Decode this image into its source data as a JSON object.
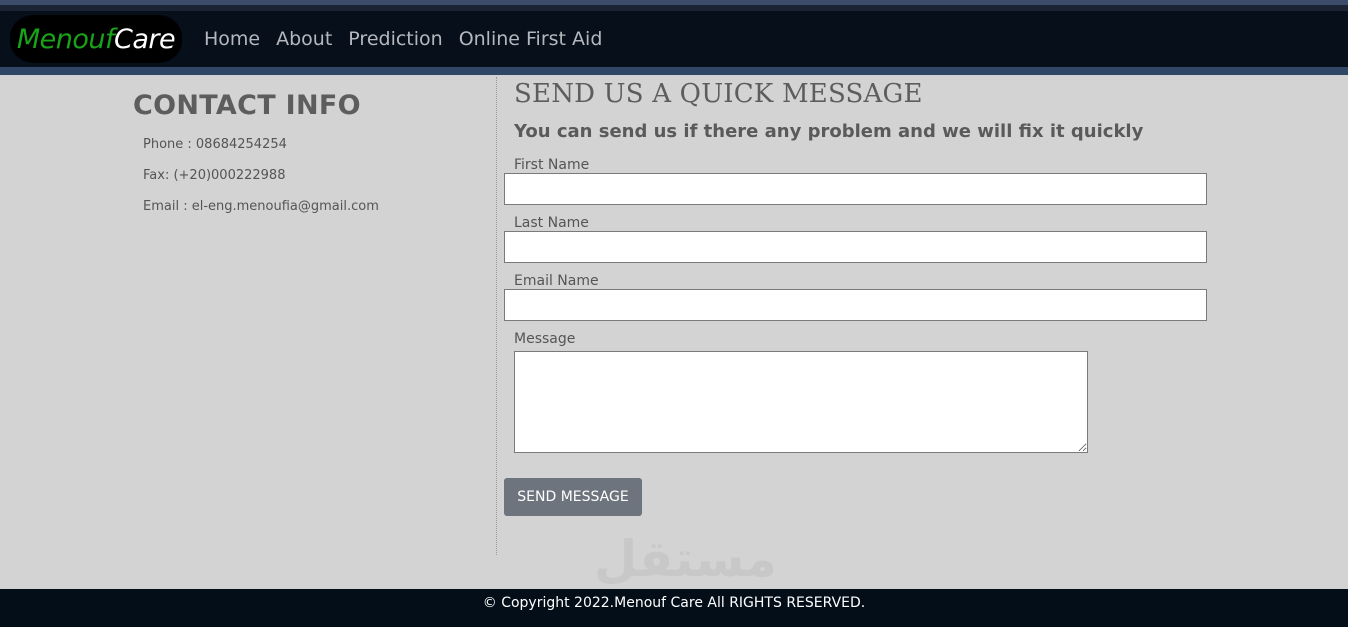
{
  "nav": {
    "logo_part1": "Menouf",
    "logo_part2": "Care",
    "links": [
      "Home",
      "About",
      "Prediction",
      "Online First Aid"
    ],
    "logo_colors": {
      "part1": "#19a319",
      "part2": "#ffffff"
    }
  },
  "contact": {
    "title": "CONTACT INFO",
    "phone": "Phone : 08684254254",
    "fax": "Fax: (+20)000222988",
    "email": "Email : el-eng.menoufia@gmail.com"
  },
  "form": {
    "title": "SEND US A QUICK MESSAGE",
    "subtitle": "You can send us if there any problem and we will fix it quickly",
    "first_name_label": "First Name",
    "first_name_value": "",
    "last_name_label": "Last Name",
    "last_name_value": "",
    "email_label": "Email Name",
    "email_value": "",
    "message_label": "Message",
    "message_value": "",
    "send_label": "SEND MESSAGE"
  },
  "watermark": "مستقل",
  "footer": {
    "text": "© Copyright 2022.Menouf Care All RIGHTS RESERVED."
  }
}
